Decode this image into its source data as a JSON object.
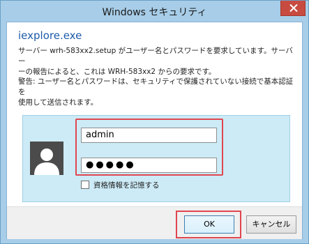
{
  "window": {
    "title": "Windows セキュリティ",
    "close_icon": "close-icon"
  },
  "dialog": {
    "app_name": "iexplore.exe",
    "description_line1": "サーバー wrh-583xx2.setup がユーザー名とパスワードを要求しています。サーバー",
    "description_line2": "ーの報告によると、これは WRH-583xx2 からの要求です。",
    "warning_line1": "警告: ユーザー名とパスワードは、セキュリティで保護されていない接続で基本認証を",
    "warning_line2": "使用して送信されます。"
  },
  "credentials": {
    "avatar_icon": "user-avatar-icon",
    "username_value": "admin",
    "password_value": "●●●●●",
    "remember_label": "資格情報を記憶する",
    "remember_checked": false
  },
  "buttons": {
    "ok_label": "OK",
    "cancel_label": "キャンセル"
  },
  "colors": {
    "title_bar": "#a7cde8",
    "close_button": "#c74b40",
    "app_title": "#1c5aa8",
    "panel": "#ccebf7",
    "highlight": "#e0464f"
  }
}
